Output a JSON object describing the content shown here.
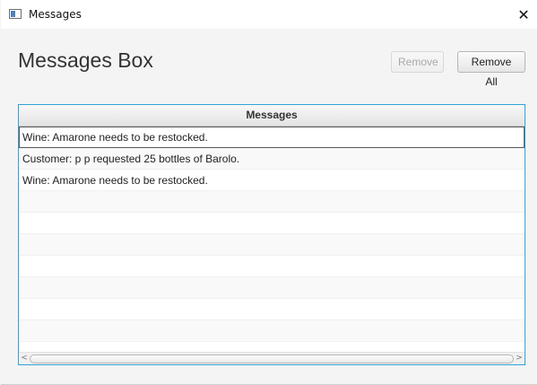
{
  "window": {
    "title": "Messages",
    "close_glyph": "✕"
  },
  "page": {
    "heading": "Messages Box"
  },
  "toolbar": {
    "remove_label": "Remove",
    "remove_all_label": "Remove All"
  },
  "table": {
    "column_header": "Messages",
    "rows": [
      "Wine: Amarone needs to be restocked.",
      "Customer: p p requested 25 bottles of Barolo.",
      "Wine: Amarone needs to be restocked.",
      "",
      "",
      "",
      "",
      "",
      "",
      "",
      ""
    ],
    "selected_index": 0
  },
  "scrollbar": {
    "left_glyph": "<",
    "right_glyph": ">"
  },
  "colors": {
    "accent": "#31a3d8",
    "disabled_text": "#a8a8a8"
  }
}
